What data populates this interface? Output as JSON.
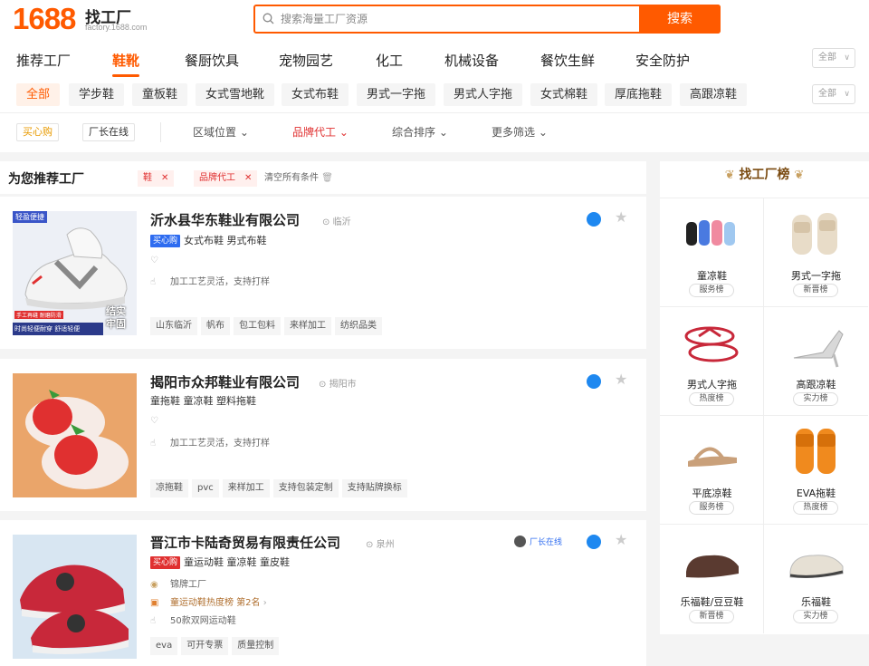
{
  "header": {
    "logo_num": "1688",
    "logo_title": "找工厂",
    "logo_domain": "factory.1688.com",
    "search_placeholder": "搜索海量工厂资源",
    "search_button": "搜索"
  },
  "categories": [
    "推荐工厂",
    "鞋靴",
    "餐厨饮具",
    "宠物园艺",
    "化工",
    "机械设备",
    "餐饮生鲜",
    "安全防护"
  ],
  "active_category": "鞋靴",
  "all_label": "全部",
  "subcategories": [
    "全部",
    "学步鞋",
    "童板鞋",
    "女式雪地靴",
    "女式布鞋",
    "男式一字拖",
    "男式人字拖",
    "女式棉鞋",
    "厚底拖鞋",
    "高跟凉鞋"
  ],
  "filters": {
    "badges": [
      "买心购",
      "厂长在线"
    ],
    "dropdowns": [
      "区域位置",
      "品牌代工",
      "综合排序",
      "更多筛选"
    ]
  },
  "recommend": {
    "title": "为您推荐工厂",
    "chips": [
      "鞋",
      "品牌代工"
    ],
    "clear": "清空所有条件"
  },
  "factories": [
    {
      "name": "沂水县华东鞋业有限公司",
      "location": "临沂",
      "badge": "买心购",
      "products": "女式布鞋 男式布鞋",
      "line1": "",
      "line2": "加工工艺灵活，支持打样",
      "tags": [
        "山东临沂",
        "帆布",
        "包工包料",
        "来样加工",
        "纺织品类"
      ],
      "thumb_text_top": "轻盈便捷",
      "thumb_text_mid": "结实牢固",
      "thumb_text_bot1": "手工再缝 耐磨防滑",
      "thumb_text_bot2": "时尚轻便耐穿 舒适轻便"
    },
    {
      "name": "揭阳市众邦鞋业有限公司",
      "location": "揭阳市",
      "products": "童拖鞋 童凉鞋 塑料拖鞋",
      "line1": "",
      "line2": "加工工艺灵活，支持打样",
      "tags": [
        "凉拖鞋",
        "pvc",
        "来样加工",
        "支持包装定制",
        "支持贴牌换标"
      ]
    },
    {
      "name": "晋江市卡陆奇贸易有限责任公司",
      "location": "泉州",
      "owner": "厂长在线",
      "badge": "买心购",
      "products": "童运动鞋 童凉鞋 童皮鞋",
      "line1": "锦牌工厂",
      "line2": "童运动鞋热度榜  第2名",
      "line3": "50款双网运动鞋",
      "tags": [
        "eva",
        "可开专票",
        "质量控制"
      ]
    }
  ],
  "ranking": {
    "title": "找工厂榜",
    "items": [
      {
        "name": "童凉鞋",
        "badge": "服务榜"
      },
      {
        "name": "男式一字拖",
        "badge": "新晋榜"
      },
      {
        "name": "男式人字拖",
        "badge": "热度榜"
      },
      {
        "name": "高跟凉鞋",
        "badge": "实力榜"
      },
      {
        "name": "平底凉鞋",
        "badge": "服务榜"
      },
      {
        "name": "EVA拖鞋",
        "badge": "热度榜"
      },
      {
        "name": "乐福鞋/豆豆鞋",
        "badge": "新晋榜"
      },
      {
        "name": "乐福鞋",
        "badge": "实力榜"
      }
    ]
  },
  "colors": {
    "accent": "#ff5a00",
    "badge_blue": "#2e6cf0",
    "tag_red": "#e03030"
  }
}
